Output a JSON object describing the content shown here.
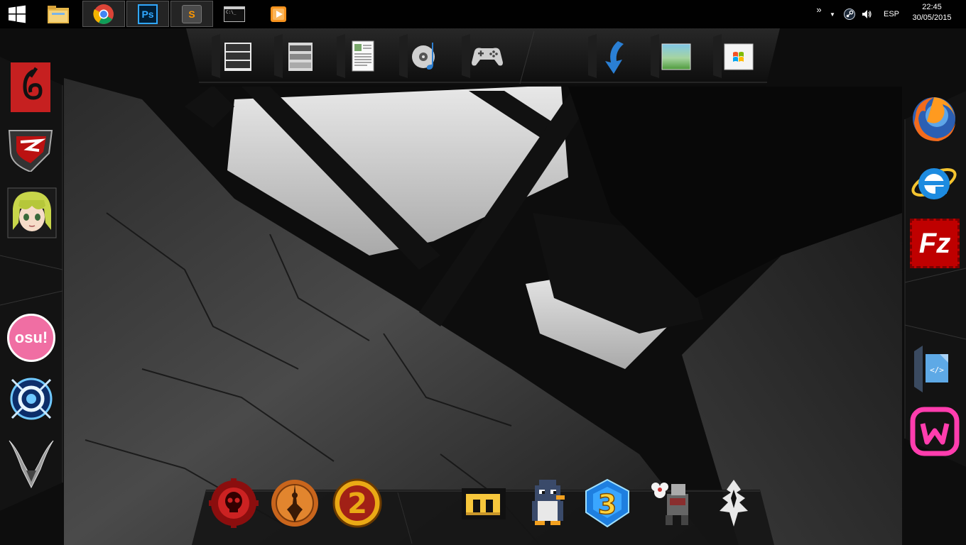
{
  "taskbar": {
    "apps": [
      {
        "name": "file-explorer"
      },
      {
        "name": "chrome",
        "active": true
      },
      {
        "name": "photoshop",
        "label": "Ps",
        "active": true
      },
      {
        "name": "sublime-text",
        "label": "S",
        "active": true
      },
      {
        "name": "command-prompt",
        "label": "C:\\_"
      },
      {
        "name": "media-player"
      }
    ],
    "tray": {
      "overflow": "»",
      "language": "ESP"
    },
    "clock": {
      "time": "22:45",
      "date": "30/05/2015"
    }
  },
  "top_dock": {
    "icons": [
      "windows-panel-icon",
      "documents-icon",
      "text-file-icon",
      "music-icon",
      "gamepad-icon",
      "downloads-icon",
      "pictures-icon",
      "windows-logo-icon"
    ]
  },
  "left_dock": {
    "icons": [
      "fiesta-online-icon",
      "s4-league-icon",
      "anime-character-icon",
      "osu-icon",
      "game-shield-icon",
      "valkyrie-icon"
    ],
    "osu_label": "osu!"
  },
  "right_dock": {
    "icons": [
      "firefox-icon",
      "internet-explorer-icon",
      "filezilla-icon",
      "code-editor-icon",
      "wampserver-icon"
    ],
    "filezilla_label": "Fz",
    "code_label": "</>"
  },
  "bottom_dock": {
    "icons": [
      "gears-of-war-icon",
      "bioshock-infinite-icon",
      "borderlands-2-icon",
      "minecraft-icon",
      "penguin-icon",
      "bejeweled-3-icon",
      "ragnarok-icon",
      "skyrim-icon"
    ],
    "borderlands_label": "2",
    "bejeweled_label": "3",
    "minecraft_label": "m"
  },
  "colors": {
    "taskbar": "#000000",
    "chrome_red": "#db4437",
    "photoshop_blue": "#31a8ff",
    "osu_pink": "#f06ea3",
    "filezilla_red": "#bf0000",
    "wamp_pink": "#ff3dae"
  }
}
